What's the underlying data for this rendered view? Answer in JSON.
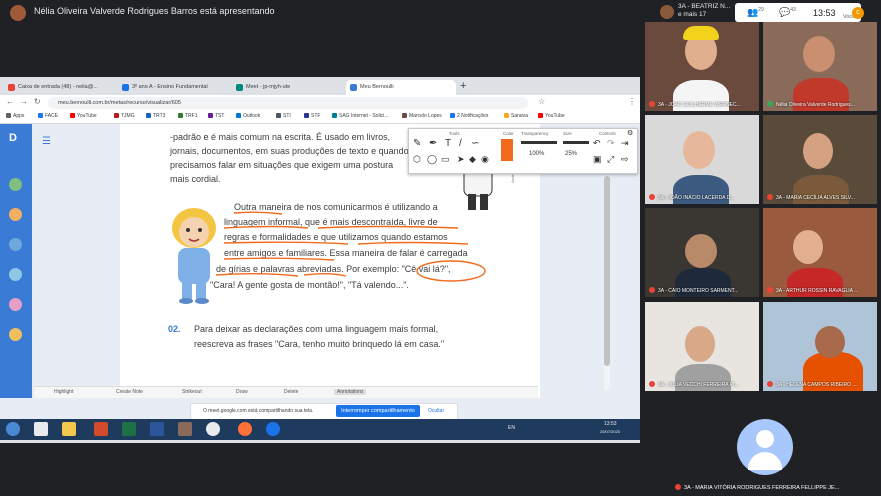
{
  "meet": {
    "presenting_text": "Nélia Oliveira Valverde Rodrigues Barros está apresentando",
    "top_participant": {
      "name": "3A - BEATRIZ N...",
      "extra": "e mais 17"
    },
    "participants_count": "29",
    "chat_count": "43",
    "time": "13:53",
    "you_label": "Você",
    "me_initial": "c"
  },
  "browser": {
    "tabs": [
      {
        "label": "Caixa de entrada (48) - nelia@...",
        "color": "#ea4335"
      },
      {
        "label": "3º ano A - Ensino Fundamental",
        "color": "#1a73e8"
      },
      {
        "label": "Meet - jp-mjyh-ute",
        "color": "#00897b"
      },
      {
        "label": "Meu Bernoulli",
        "color": "#3a7bd5"
      }
    ],
    "url": "meu.bernoulli.com.br/metas/recurso/visualizar/605",
    "bookmarks": [
      {
        "label": "Apps",
        "color": "#5f6368"
      },
      {
        "label": "FACE",
        "color": "#1877f2"
      },
      {
        "label": "YouTube",
        "color": "#ff0000"
      },
      {
        "label": "TJMG",
        "color": "#b71c1c"
      },
      {
        "label": "TRT3",
        "color": "#1565c0"
      },
      {
        "label": "TRF1",
        "color": "#2e7d32"
      },
      {
        "label": "TST",
        "color": "#6a1b9a"
      },
      {
        "label": "Outlook",
        "color": "#0078d4"
      },
      {
        "label": "STI",
        "color": "#455a64"
      },
      {
        "label": "STF",
        "color": "#283593"
      },
      {
        "label": "SAG Internet - Solici...",
        "color": "#00838f"
      },
      {
        "label": "Marcelo Lopes",
        "color": "#6d4c41"
      },
      {
        "label": "2 Notificações",
        "color": "#1877f2"
      },
      {
        "label": "Saraiva",
        "color": "#f9a825"
      },
      {
        "label": "YouTube",
        "color": "#ff0000"
      }
    ]
  },
  "toolbar": {
    "labels": {
      "tools": "Tools",
      "color": "Color",
      "transparency": "Transparency",
      "size": "Size",
      "controls": "Controls"
    },
    "transparency_value": "100%",
    "size_value": "25%",
    "accent": "#f26b1d"
  },
  "document": {
    "lines": [
      "-padrão e é mais comum na escrita. É usado em livros,",
      "jornais, documentos, em suas produções de texto e quando",
      "precisamos falar em situações que exigem uma postura",
      "mais cordial.",
      "Outra maneira de nos comunicarmos é utilizando a",
      "linguagem informal, que é mais descontraída, livre de",
      "regras e formalidades e que utilizamos quando estamos",
      "entre amigos e familiares. Essa maneira de falar é carregada",
      "de gírias e palavras abreviadas. Por exemplo: \"Cê vai lá?\",",
      "\"Cara! A gente gosta de montão!\", \"Tá valendo...\"."
    ],
    "question_number": "02.",
    "question_line1": "Para deixar as declarações com uma linguagem mais formal,",
    "question_line2": "reescreva as frases \"Cara, tenho muito brinquedo lá em casa.\"",
    "side_text": "ilustração"
  },
  "annotations_bar": [
    "Highlight",
    "Create Note",
    "Strikeout",
    "Draw",
    "Delete",
    "Annotations"
  ],
  "share_banner": {
    "message": "O meet.google.com está compartilhando sua tela.",
    "stop_label": "Interromper compartilhamento",
    "hide_label": "Ocultar"
  },
  "taskbar": {
    "lang": "EN",
    "time": "13:53",
    "date": "25/07/2020"
  },
  "participants": [
    {
      "name": "3A - JOÃO GUILHERME WERNEC...",
      "bg": "#6b4a3e",
      "skin": "#e0b08e",
      "shirt": "#f5f5f5"
    },
    {
      "name": "Nélia Oliveira Valverde Rodrigues...",
      "bg": "#8a6b5a",
      "skin": "#c98f6f",
      "shirt": "#c0392b"
    },
    {
      "name": "3A - JOÃO INÁCIO LACERDA D...",
      "bg": "#d9d9d9",
      "skin": "#e6b79a",
      "shirt": "#3d5a80"
    },
    {
      "name": "3A - MARIA CECÍLIA ALVES SILV...",
      "bg": "#5a4a3a",
      "skin": "#d4a182",
      "shirt": "#7a5a3a"
    },
    {
      "name": "3A - CAIO MONTEIRO SARMENT...",
      "bg": "#3a3632",
      "skin": "#b98a6a",
      "shirt": "#1e2a3a"
    },
    {
      "name": "3A - ARTHUR ROSSIN RAVAGLIA ...",
      "bg": "#9a5a3e",
      "skin": "#e2b090",
      "shirt": "#c62828"
    },
    {
      "name": "3A - JÚLIA VECCHI FERREIRA PI...",
      "bg": "#e8e4e0",
      "skin": "#d8a888",
      "shirt": "#a0a0a0"
    },
    {
      "name": "3A - HELENA CAMPOS RIBEIRO ...",
      "bg": "#b0c4d8",
      "skin": "#a86a4a",
      "shirt": "#e65100"
    }
  ],
  "last_participant": "3A - MARIA VITÓRIA RODRIGUES FERREIRA FELLIPPE JE..."
}
